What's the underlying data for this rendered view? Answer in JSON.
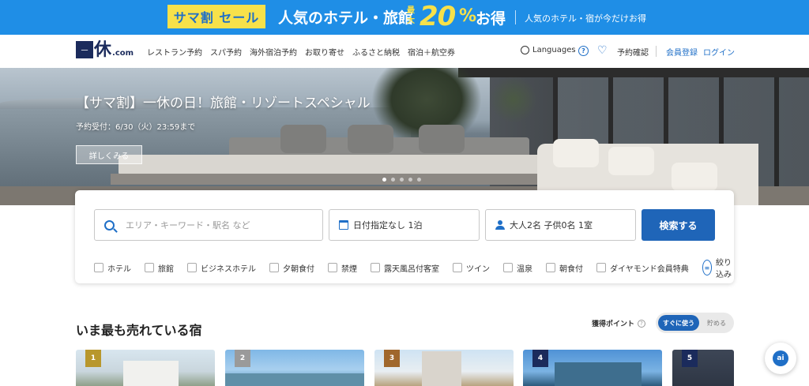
{
  "promo": {
    "tag": "サマ割 セール",
    "main": "人気のホテル・旅館",
    "max_label": "最大",
    "percent": "20",
    "percent_symbol": "%",
    "deal": "お得",
    "sub": "人気のホテル・宿が今だけお得"
  },
  "header": {
    "logo_mark": "一",
    "logo_text": "休",
    "logo_suffix": ".com",
    "nav": [
      "レストラン予約",
      "スパ予約",
      "海外宿泊予約",
      "お取り寄せ",
      "ふるさと納税",
      "宿泊＋航空券"
    ],
    "languages": "Languages",
    "reservation": "予約確認",
    "register": "会員登録",
    "login": "ログイン"
  },
  "hero": {
    "title": "【サマ割】一休の日！旅館・リゾートスペシャル",
    "date": "予約受付：6/30（火）23:59まで",
    "button": "詳しくみる",
    "slide_count": 5,
    "active_slide": 1
  },
  "search": {
    "area_placeholder": "エリア・キーワード・駅名 など",
    "date_value": "日付指定なし 1泊",
    "guests_value": "大人2名  子供0名  1室",
    "button": "検索する",
    "filters": [
      "ホテル",
      "旅館",
      "ビジネスホテル",
      "夕朝食付",
      "禁煙",
      "露天風呂付客室",
      "ツイン",
      "温泉",
      "朝食付",
      "ダイヤモンド会員特典"
    ],
    "narrow_icon": "≡",
    "narrow_label": "絞り込み"
  },
  "ranking": {
    "title": "いま最も売れている宿",
    "points_label": "獲得ポイント",
    "info_icon": "?",
    "toggle_on": "すぐに使う",
    "toggle_off": "貯める",
    "cards": [
      {
        "rank": "1",
        "badge_color": "#b8972c"
      },
      {
        "rank": "2",
        "badge_color": "#9a9a9a"
      },
      {
        "rank": "3",
        "badge_color": "#a0672c"
      },
      {
        "rank": "4",
        "badge_color": "#1b2b5c"
      },
      {
        "rank": "5",
        "badge_color": "#1b2b5c"
      }
    ]
  },
  "ai": {
    "label": "ai"
  },
  "colors": {
    "brand_blue": "#1f65b8",
    "promo_blue": "#1f8ee6",
    "promo_yellow": "#f7e14a",
    "logo_navy": "#1b2b5c"
  }
}
